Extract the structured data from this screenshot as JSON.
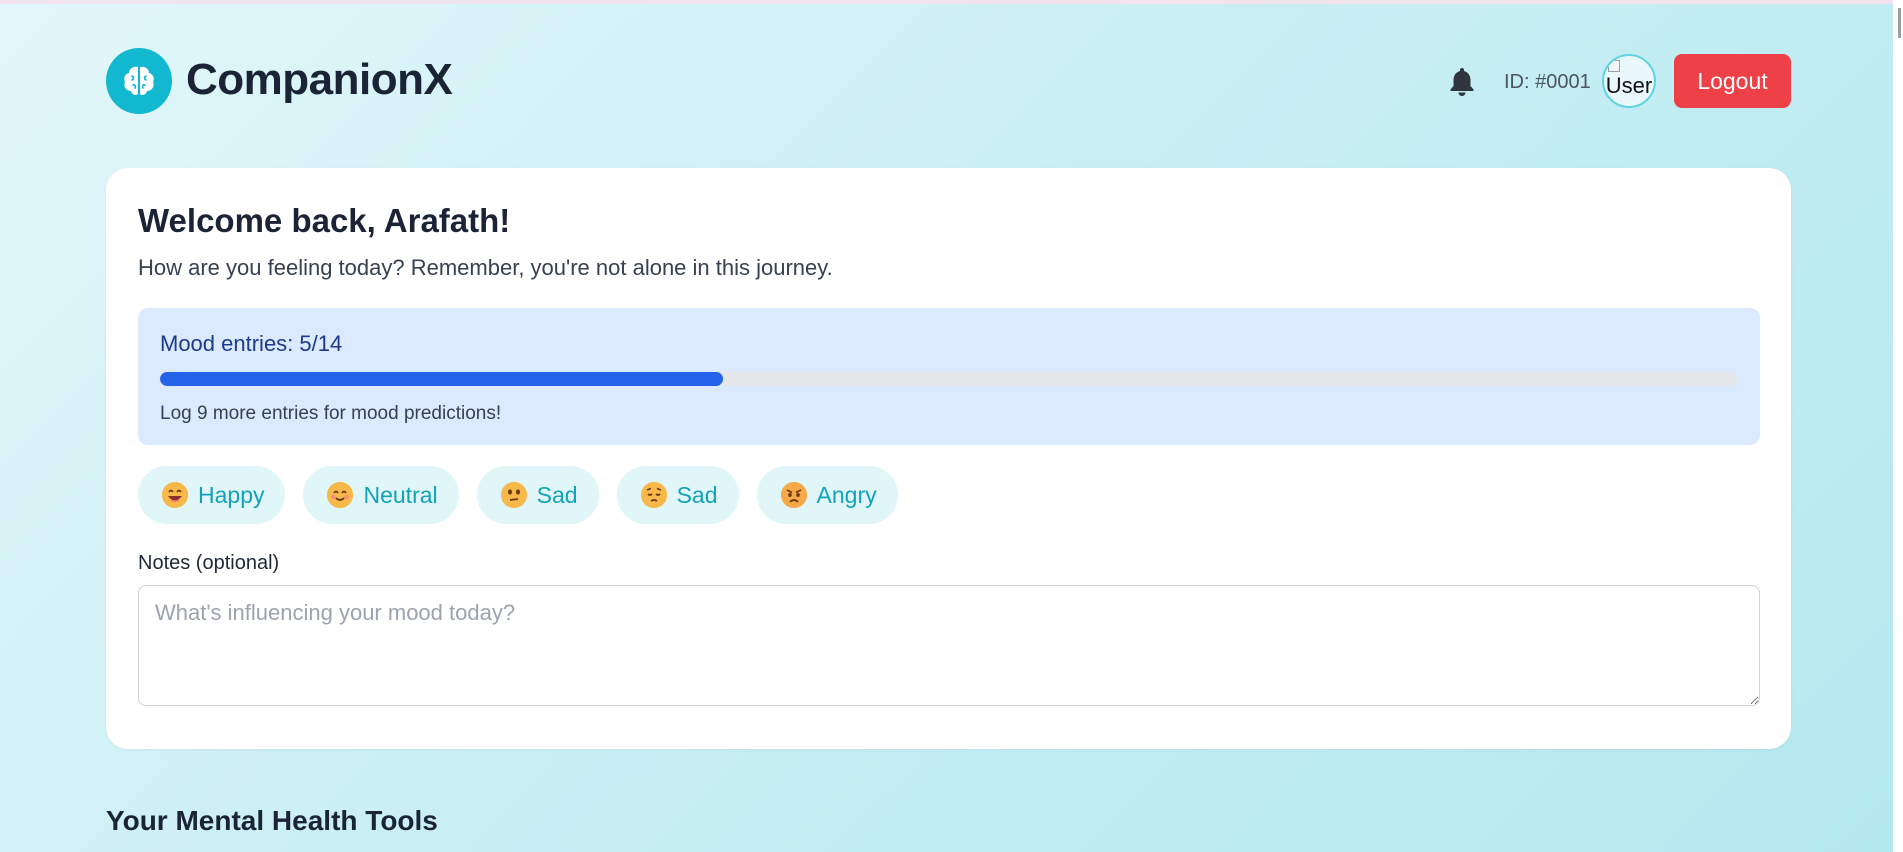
{
  "app": {
    "brand": "CompanionX",
    "user_id": "ID: #0001",
    "avatar_alt": "User",
    "logout_label": "Logout"
  },
  "colors": {
    "accent": "#12b8cf",
    "danger": "#ee4147",
    "progress": "#2563eb",
    "progress_bg": "#dbeafe"
  },
  "icons": {
    "logo": "brain-icon",
    "notifications": "bell-icon"
  },
  "welcome": {
    "title": "Welcome back, Arafath!",
    "subtitle": "How are you feeling today? Remember, you're not alone in this journey."
  },
  "mood_progress": {
    "label": "Mood entries: 5/14",
    "current": 5,
    "total": 14,
    "hint": "Log 9 more entries for mood predictions!"
  },
  "moods": [
    {
      "label": "Happy",
      "icon": "grinning-face-icon"
    },
    {
      "label": "Neutral",
      "icon": "smiling-face-icon"
    },
    {
      "label": "Sad",
      "icon": "confused-face-icon"
    },
    {
      "label": "Sad",
      "icon": "pensive-face-icon"
    },
    {
      "label": "Angry",
      "icon": "angry-face-icon"
    }
  ],
  "notes": {
    "label": "Notes (optional)",
    "placeholder": "What's influencing your mood today?",
    "value": ""
  },
  "tools_section": {
    "title": "Your Mental Health Tools"
  }
}
